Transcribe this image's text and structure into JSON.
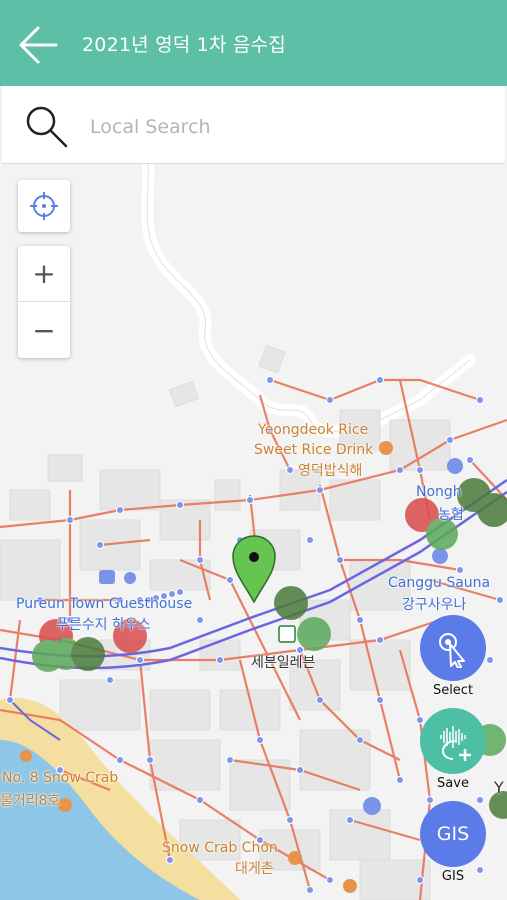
{
  "header": {
    "title": "2021년 영덕 1차 음수집",
    "back_icon": "arrow-left-icon"
  },
  "search": {
    "placeholder": "Local Search",
    "value": "",
    "icon": "search-icon"
  },
  "map_controls": {
    "zoom_in_label": "+",
    "zoom_out_label": "−",
    "locate_icon": "crosshair-icon"
  },
  "map_labels": {
    "yeongdeok_rice_en": "Yeongdeok Rice",
    "sweet_rice_drink_en": "Sweet Rice Drink",
    "yeongdeok_rice_ko": "영덕밥식해",
    "nonghyup_en": "Nongh",
    "nonghyup_ko": "농협",
    "canggu_sauna_en": "Canggu Sauna",
    "canggu_sauna_ko": "강구사우나",
    "pureun_town_en": "Pureun Town Guesthouse",
    "pureun_town_ko": "푸른수지 하우스",
    "seven_eleven_ko": "세븐일레븐",
    "snow_crab_no8_en": "No. 8 Snow Crab",
    "snow_crab_no8_ko": "물거리8호",
    "snow_crab_chon_en": "Snow Crab Chon",
    "snow_crab_chon_ko": "대게촌",
    "edge_letter": "Y"
  },
  "actions": {
    "select_label": "Select",
    "save_label": "Save",
    "gis_label": "GIS",
    "gis_button_text": "GIS"
  },
  "colors": {
    "header": "#5dbfa6",
    "fab_blue": "#5b7be8",
    "fab_green": "#4dbfa5",
    "marker_green": "#4caf50",
    "road_red": "#e8735a",
    "road_purple": "#6b66e0"
  }
}
